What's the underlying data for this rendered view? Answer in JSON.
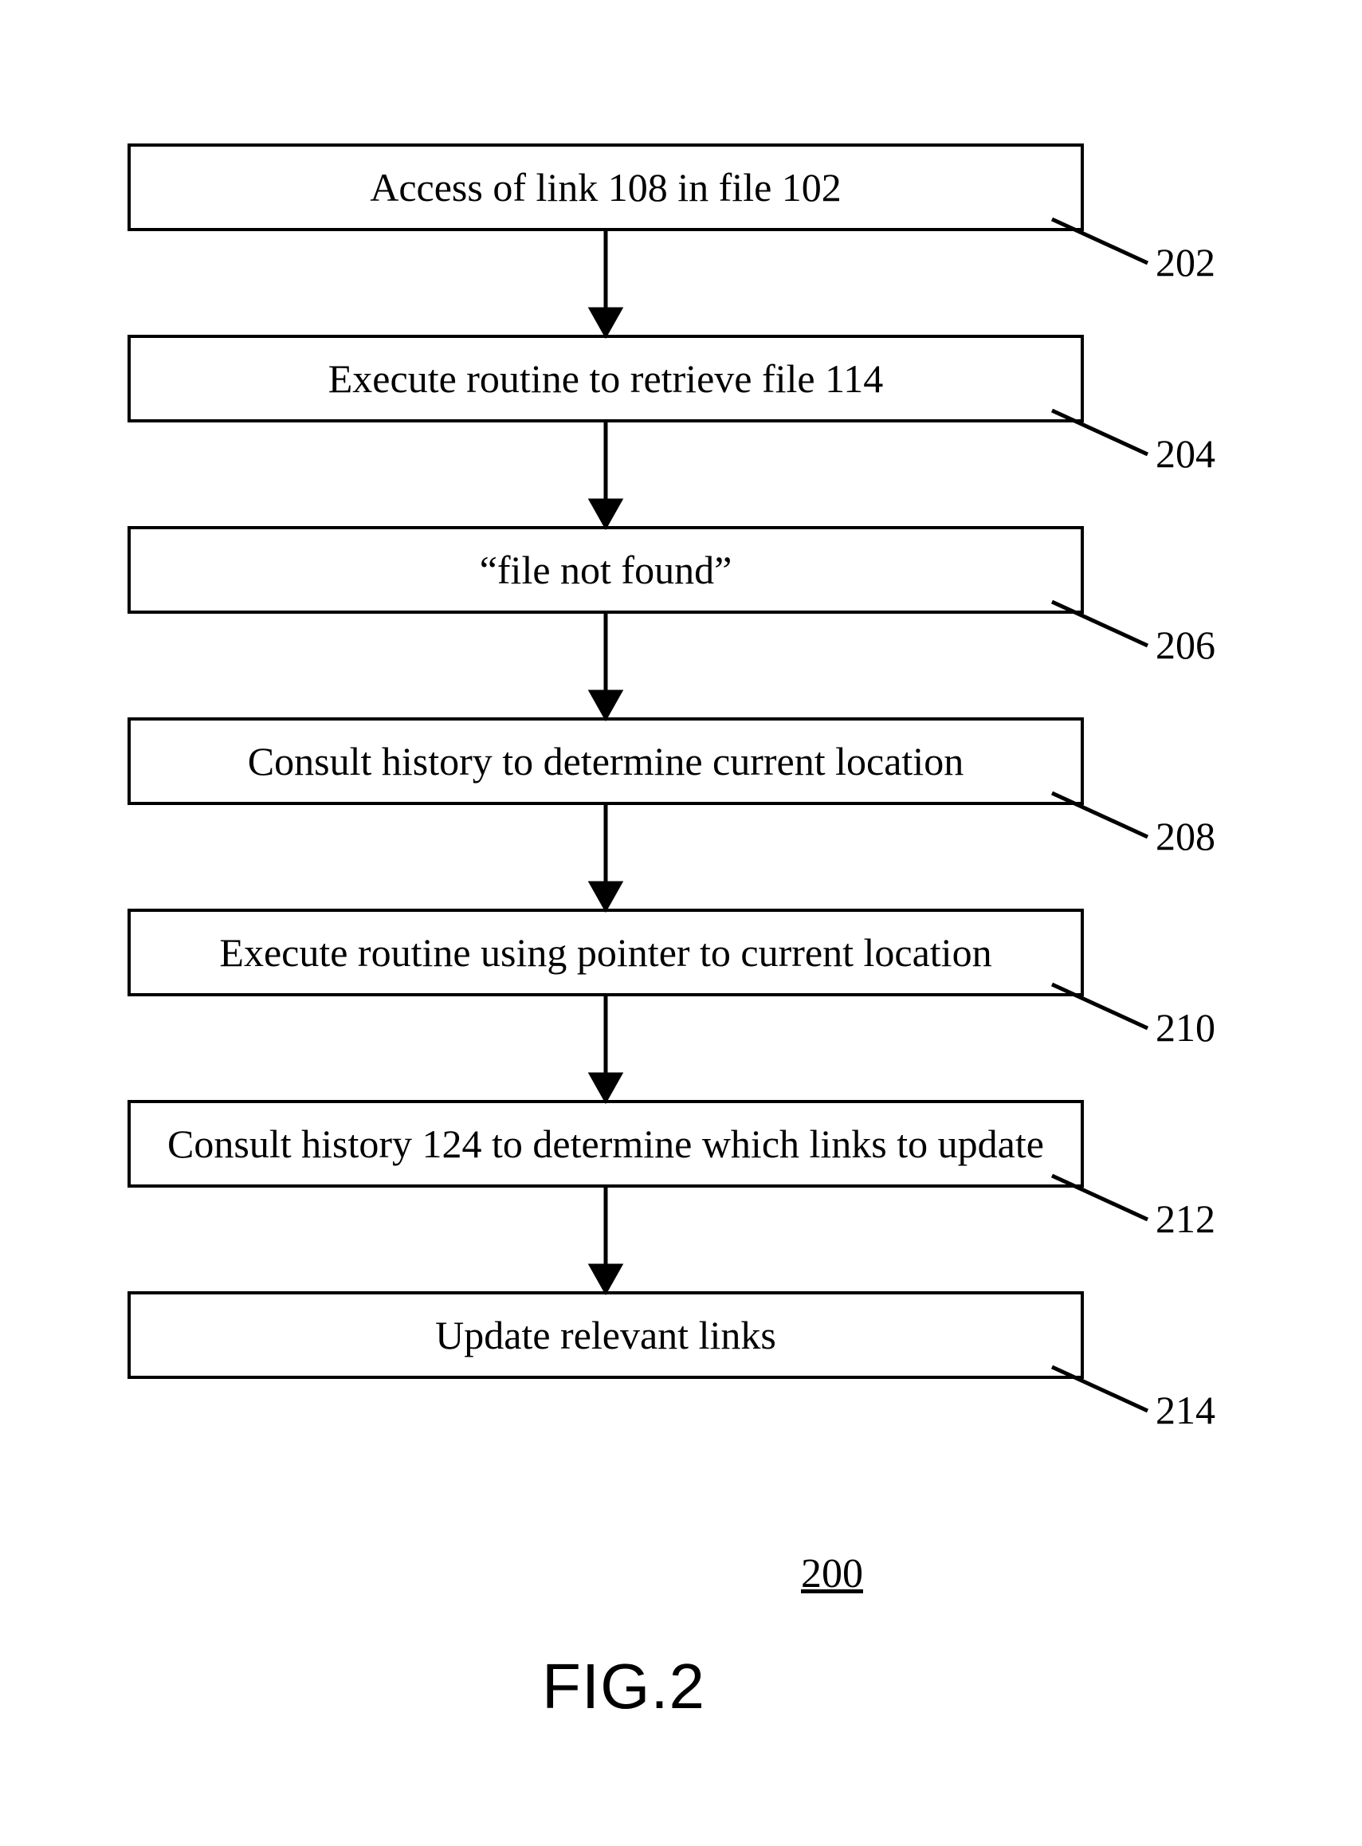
{
  "steps": [
    {
      "id": "202",
      "text": "Access of link 108 in file 102"
    },
    {
      "id": "204",
      "text": "Execute routine to retrieve file 114"
    },
    {
      "id": "206",
      "text": "“file not found”"
    },
    {
      "id": "208",
      "text": "Consult history to determine current location"
    },
    {
      "id": "210",
      "text": "Execute routine using pointer to current location"
    },
    {
      "id": "212",
      "text": "Consult history 124 to determine which links to update"
    },
    {
      "id": "214",
      "text": "Update relevant links"
    }
  ],
  "figure_number": "200",
  "figure_caption": "FIG.2"
}
